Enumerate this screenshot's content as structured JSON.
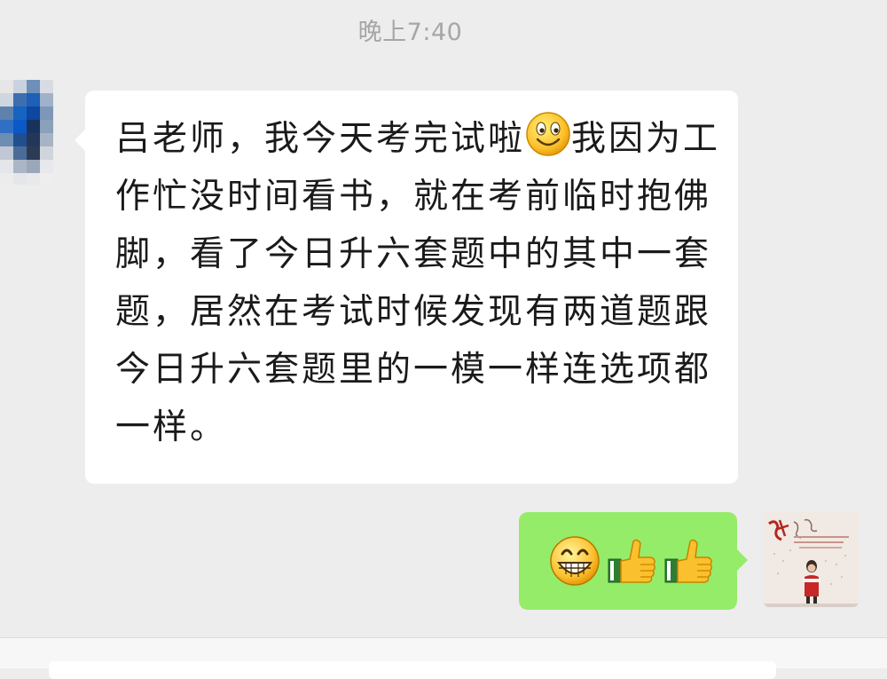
{
  "chat": {
    "timestamp": "晚上7:40",
    "incoming_message": {
      "text_before_emoji": "吕老师，我今天考完试啦",
      "emoji": "smile-emoji",
      "text_after_emoji": "我因为工作忙没时间看书，就在考前临时抱佛脚，看了今日升六套题中的其中一套题，居然在考试时候发现有两道题跟今日升六套题里的一模一样连选项都一样。"
    },
    "outgoing_message": {
      "emojis": [
        "grin-emoji",
        "thumbs-up-emoji",
        "thumbs-up-emoji"
      ]
    },
    "avatars": {
      "left": "pixelated-avatar",
      "right": "photo-avatar"
    }
  },
  "colors": {
    "background": "#ededed",
    "incoming_bubble": "#ffffff",
    "outgoing_bubble": "#95ec69",
    "timestamp": "#a6a6a6"
  }
}
